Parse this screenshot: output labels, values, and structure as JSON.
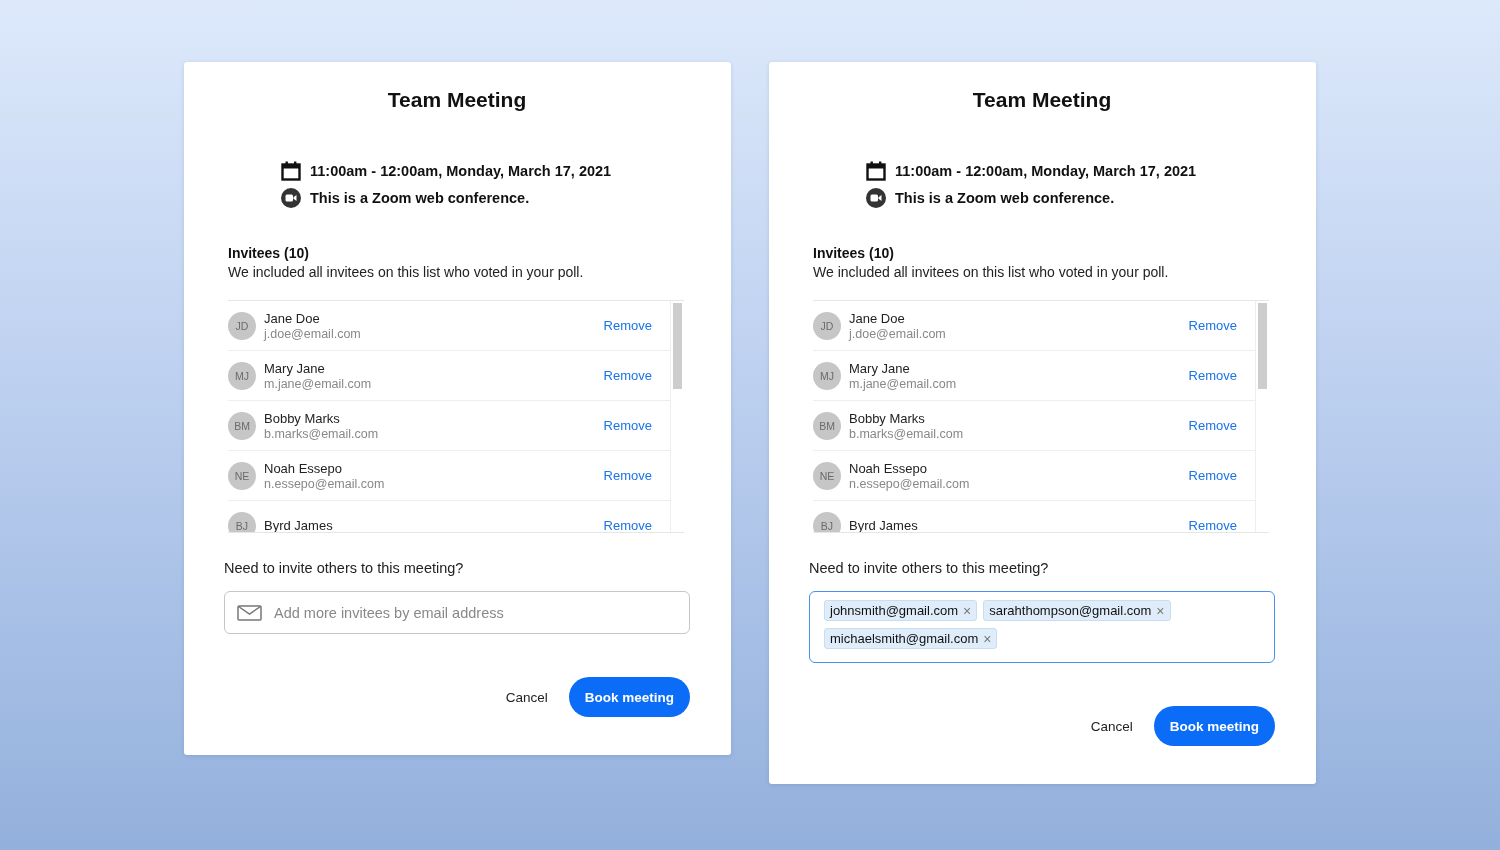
{
  "panels": [
    {
      "title": "Team Meeting",
      "schedule": {
        "time": "11:00am - 12:00am, Monday, March 17, 2021",
        "conference": "This is a Zoom web conference."
      },
      "invitees": {
        "heading": "Invitees (10)",
        "note": "We included all invitees on this list who voted in your poll.",
        "items": [
          {
            "initials": "JD",
            "name": "Jane Doe",
            "email": "j.doe@email.com",
            "action": "Remove"
          },
          {
            "initials": "MJ",
            "name": "Mary Jane",
            "email": "m.jane@email.com",
            "action": "Remove"
          },
          {
            "initials": "BM",
            "name": "Bobby Marks",
            "email": "b.marks@email.com",
            "action": "Remove"
          },
          {
            "initials": "NE",
            "name": "Noah Essepo",
            "email": "n.essepo@email.com",
            "action": "Remove"
          },
          {
            "initials": "BJ",
            "name": "Byrd James",
            "action": "Remove"
          }
        ]
      },
      "invite": {
        "prompt": "Need to invite others to this meeting?",
        "focused": false,
        "placeholder": "Add more invitees by email address"
      },
      "buttons": [
        {
          "label": "Cancel",
          "kind": "text"
        },
        {
          "label": "Book meeting",
          "kind": "primary"
        }
      ]
    },
    {
      "title": "Team Meeting",
      "schedule": {
        "time": "11:00am - 12:00am, Monday, March 17, 2021",
        "conference": "This is a Zoom web conference."
      },
      "invitees": {
        "heading": "Invitees (10)",
        "note": "We included all invitees on this list who voted in your poll.",
        "items": [
          {
            "initials": "JD",
            "name": "Jane Doe",
            "email": "j.doe@email.com",
            "action": "Remove"
          },
          {
            "initials": "MJ",
            "name": "Mary Jane",
            "email": "m.jane@email.com",
            "action": "Remove"
          },
          {
            "initials": "BM",
            "name": "Bobby Marks",
            "email": "b.marks@email.com",
            "action": "Remove"
          },
          {
            "initials": "NE",
            "name": "Noah Essepo",
            "email": "n.essepo@email.com",
            "action": "Remove"
          },
          {
            "initials": "BJ",
            "name": "Byrd James",
            "action": "Remove"
          }
        ]
      },
      "invite": {
        "prompt": "Need to invite others to this meeting?",
        "focused": true,
        "chips": [
          {
            "label": "johnsmith@gmail.com",
            "remove": "×"
          },
          {
            "label": "sarahthompson@gmail.com",
            "remove": "×"
          },
          {
            "label": "michaelsmith@gmail.com",
            "remove": "×"
          }
        ]
      },
      "buttons": [
        {
          "label": "Cancel",
          "kind": "text"
        },
        {
          "label": "Book meeting",
          "kind": "primary"
        }
      ]
    }
  ]
}
